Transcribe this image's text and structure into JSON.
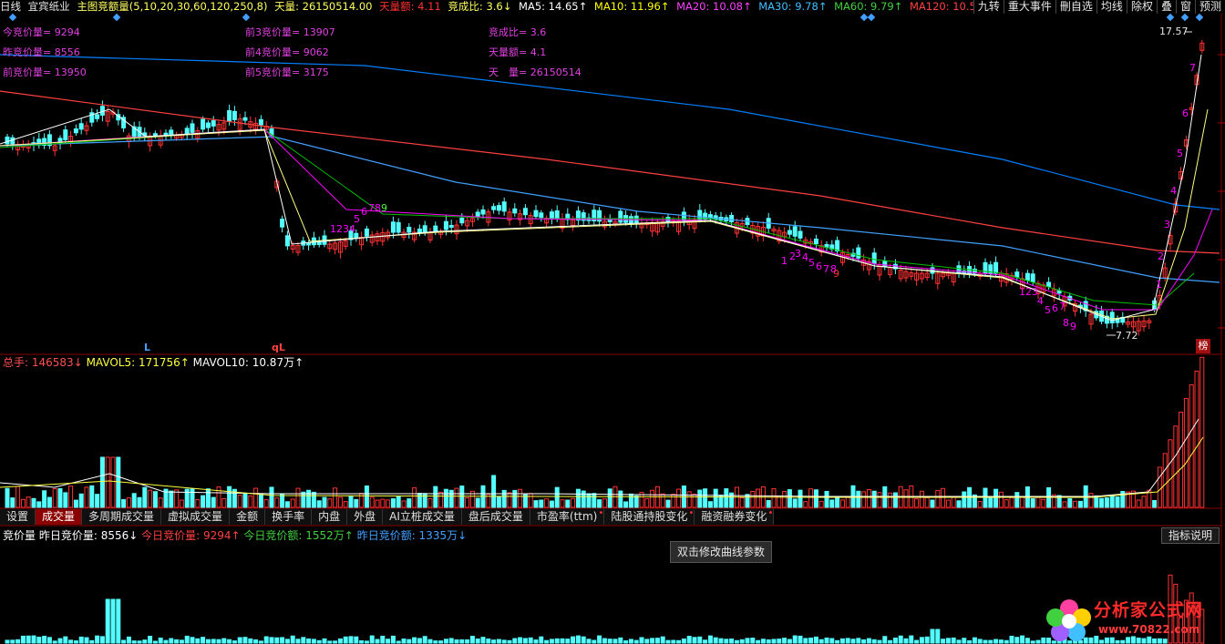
{
  "header": {
    "period": "日线",
    "stock": "宜宾纸业",
    "indicator": "主图竞额量(5,10,20,30,60,120,250,8)",
    "tianliang": "天量: 26150514.00",
    "tianliange": "天量额: 4.11",
    "jingchengbi": "竞成比: 3.6↓",
    "ma5": "MA5: 14.65↑",
    "ma10": "MA10: 11.96↑",
    "ma20": "MA20: 10.08↑",
    "ma30": "MA30: 9.78↑",
    "ma60": "MA60: 9.79↑",
    "ma120": "MA120: 10.52↑",
    "ma_more": "M"
  },
  "toolbar": [
    "九转",
    "重大事件",
    "刪自选",
    "均线",
    "除权",
    "叠",
    "窗",
    "预测"
  ],
  "info": {
    "c1": [
      "今竞价量= 9294",
      "昨竞价量= 8556",
      "前竞价量= 13950"
    ],
    "c2": [
      "前3竞价量= 13907",
      "前4竞价量= 9062",
      "前5竞价量= 3175"
    ],
    "c3": [
      "竞成比= 3.6",
      "天量额= 4.1",
      "天　量= 26150514"
    ]
  },
  "price": {
    "high_label": "17.57",
    "low_label": "7.72",
    "marker_L": "L",
    "marker_qL": "qL",
    "bang": "榜"
  },
  "volume": {
    "total": "总手: 146583↓",
    "mavol5": "MAVOL5: 171756↑",
    "mavol10": "MAVOL10: 10.87万↑"
  },
  "tabs": [
    {
      "label": "设置",
      "dot": false
    },
    {
      "label": "成交量",
      "dot": false,
      "active": true
    },
    {
      "label": "多周期成交量",
      "dot": false
    },
    {
      "label": "虚拟成交量",
      "dot": false
    },
    {
      "label": "金额",
      "dot": false
    },
    {
      "label": "换手率",
      "dot": false
    },
    {
      "label": "内盘",
      "dot": false
    },
    {
      "label": "外盘",
      "dot": false
    },
    {
      "label": "AI立桩成交量",
      "dot": false
    },
    {
      "label": "盘后成交量",
      "dot": false
    },
    {
      "label": "市盈率(ttm)",
      "dot": true
    },
    {
      "label": "陆股通持股变化",
      "dot": true
    },
    {
      "label": "融资融券变化",
      "dot": true
    }
  ],
  "auction": {
    "name": "竞价量",
    "yesterday": "昨日竞价量: 8556↓",
    "today": "今日竞价量: 9294↑",
    "today_amt": "今日竞价额: 1552万↑",
    "yest_amt": "昨日竞价额: 1335万↓"
  },
  "tooltip": "双击修改曲线参数",
  "help": "指标说明",
  "watermark": {
    "title": "分析家公式网",
    "url": "www.70822.com"
  },
  "colors": {
    "up": "#ff3232",
    "down": "#54ffff",
    "ma5": "#ffffff",
    "ma10": "#ffff00",
    "ma20": "#ff00ff",
    "ma30": "#00c000",
    "ma60": "#40a0ff",
    "ma120": "#ff4040",
    "ma250": "#0080ff"
  }
}
